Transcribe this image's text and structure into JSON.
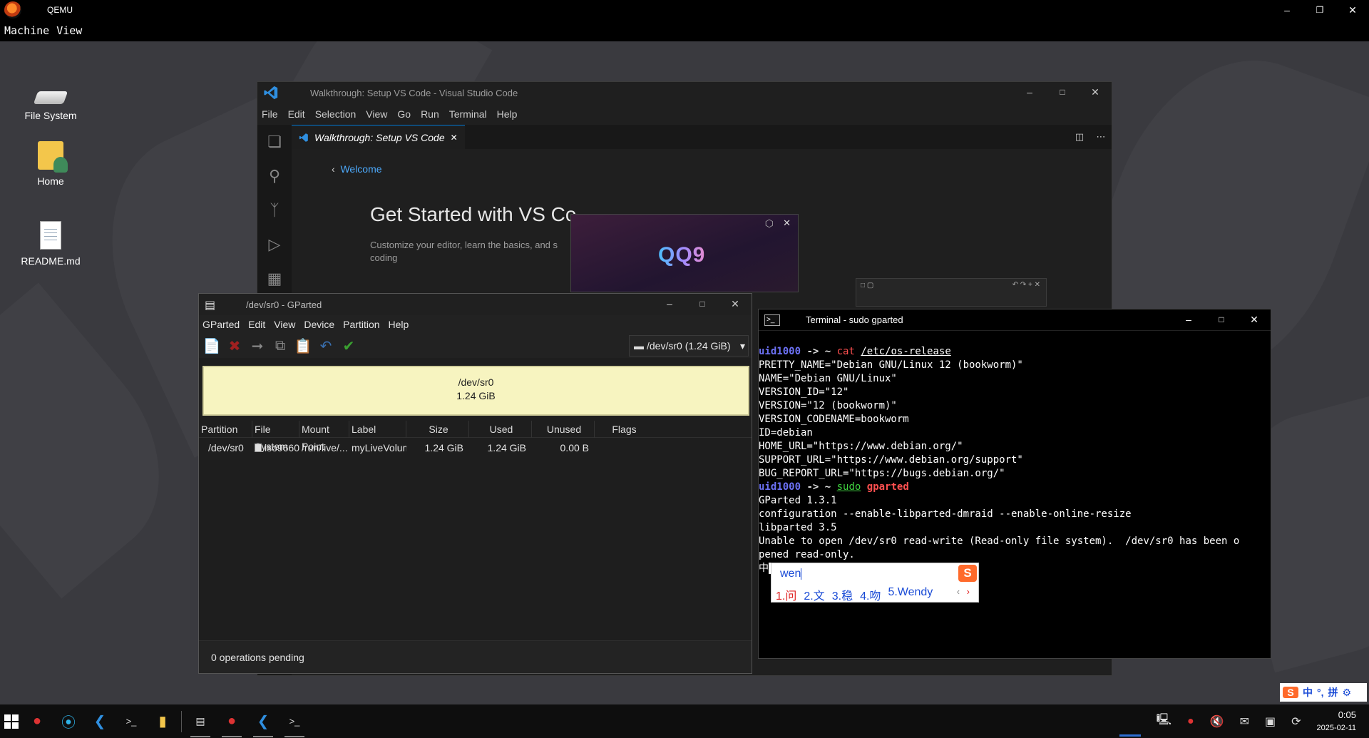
{
  "qemu": {
    "title": "QEMU",
    "menu": [
      "Machine",
      "View"
    ]
  },
  "desktop": {
    "icons": [
      {
        "label": "File System",
        "icon": "drive-icon"
      },
      {
        "label": "Home",
        "icon": "home-folder-icon"
      },
      {
        "label": "README.md",
        "icon": "document-icon"
      }
    ]
  },
  "vscode": {
    "title": "Walkthrough: Setup VS Code - Visual Studio Code",
    "menu": [
      "File",
      "Edit",
      "Selection",
      "View",
      "Go",
      "Run",
      "Terminal",
      "Help"
    ],
    "tab_label": "Walkthrough: Setup VS Code",
    "back_link": "Welcome",
    "heading": "Get Started with VS Co",
    "subtext": "Customize your editor, learn the basics, and s coding",
    "accent": "#0078d4"
  },
  "qq_popup": {
    "logo_text": "QQ9"
  },
  "gparted": {
    "title": "/dev/sr0 - GParted",
    "menu": [
      "GParted",
      "Edit",
      "View",
      "Device",
      "Partition",
      "Help"
    ],
    "device_selector": "/dev/sr0 (1.24 GiB)",
    "disk_map": {
      "name": "/dev/sr0",
      "size": "1.24 GiB"
    },
    "columns": [
      "Partition",
      "File System",
      "Mount Point",
      "Label",
      "Size",
      "Used",
      "Unused",
      "Flags"
    ],
    "rows": [
      {
        "partition": "/dev/sr0",
        "filesystem": "iso9660",
        "mount_point": "/run/live/...",
        "label": "myLiveVolume",
        "size": "1.24 GiB",
        "used": "1.24 GiB",
        "unused": "0.00 B",
        "flags": ""
      }
    ],
    "status": "0 operations pending"
  },
  "terminal": {
    "title": "Terminal - sudo gparted",
    "prompt_user": "uid1000",
    "prompt_sep": " -> ",
    "prompt_dir": "~",
    "cmd1_name": "cat",
    "cmd1_arg": "/etc/os-release",
    "output1": [
      "PRETTY_NAME=\"Debian GNU/Linux 12 (bookworm)\"",
      "NAME=\"Debian GNU/Linux\"",
      "VERSION_ID=\"12\"",
      "VERSION=\"12 (bookworm)\"",
      "VERSION_CODENAME=bookworm",
      "ID=debian",
      "HOME_URL=\"https://www.debian.org/\"",
      "SUPPORT_URL=\"https://www.debian.org/support\"",
      "BUG_REPORT_URL=\"https://bugs.debian.org/\""
    ],
    "cmd2_name": "sudo",
    "cmd2_arg": "gparted",
    "output2": [
      "GParted 1.3.1",
      "configuration --enable-libparted-dmraid --enable-online-resize",
      "libparted 3.5",
      "Unable to open /dev/sr0 read-write (Read-only file system).  /dev/sr0 has been o",
      "pened read-only."
    ],
    "input_prefix": "中"
  },
  "ime": {
    "input": "wen",
    "candidates": [
      "1.问",
      "2.文",
      "3.稳",
      "4.吻",
      "5.Wendy"
    ],
    "logo": "S"
  },
  "ime_bar": {
    "logo": "S",
    "mode": "中",
    "punct": "°,",
    "pinyin": "拼"
  },
  "taskbar": {
    "time": "0:05",
    "date": "2025-02-11"
  }
}
